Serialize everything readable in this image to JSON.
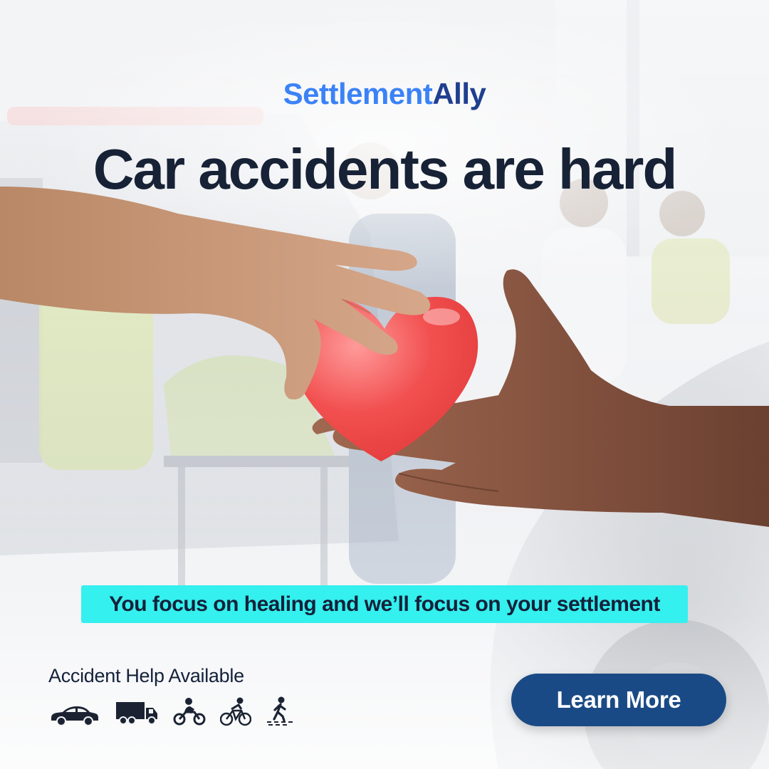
{
  "brand": {
    "name_part1": "Settlement",
    "name_part2": "Ally",
    "color_primary": "#3b82f6",
    "color_secondary": "#1f3f8f"
  },
  "headline": "Car accidents are hard",
  "tagline": "You focus on healing and we’ll focus on your settlement",
  "help": {
    "title": "Accident Help Available",
    "icons": [
      "car-icon",
      "truck-icon",
      "motorcycle-icon",
      "bicycle-icon",
      "pedestrian-icon"
    ]
  },
  "cta": {
    "label": "Learn More",
    "color": "#1a4a86"
  },
  "colors": {
    "tagline_bg": "#34f0ee",
    "text_dark": "#14213a",
    "heart": "#f04848"
  }
}
